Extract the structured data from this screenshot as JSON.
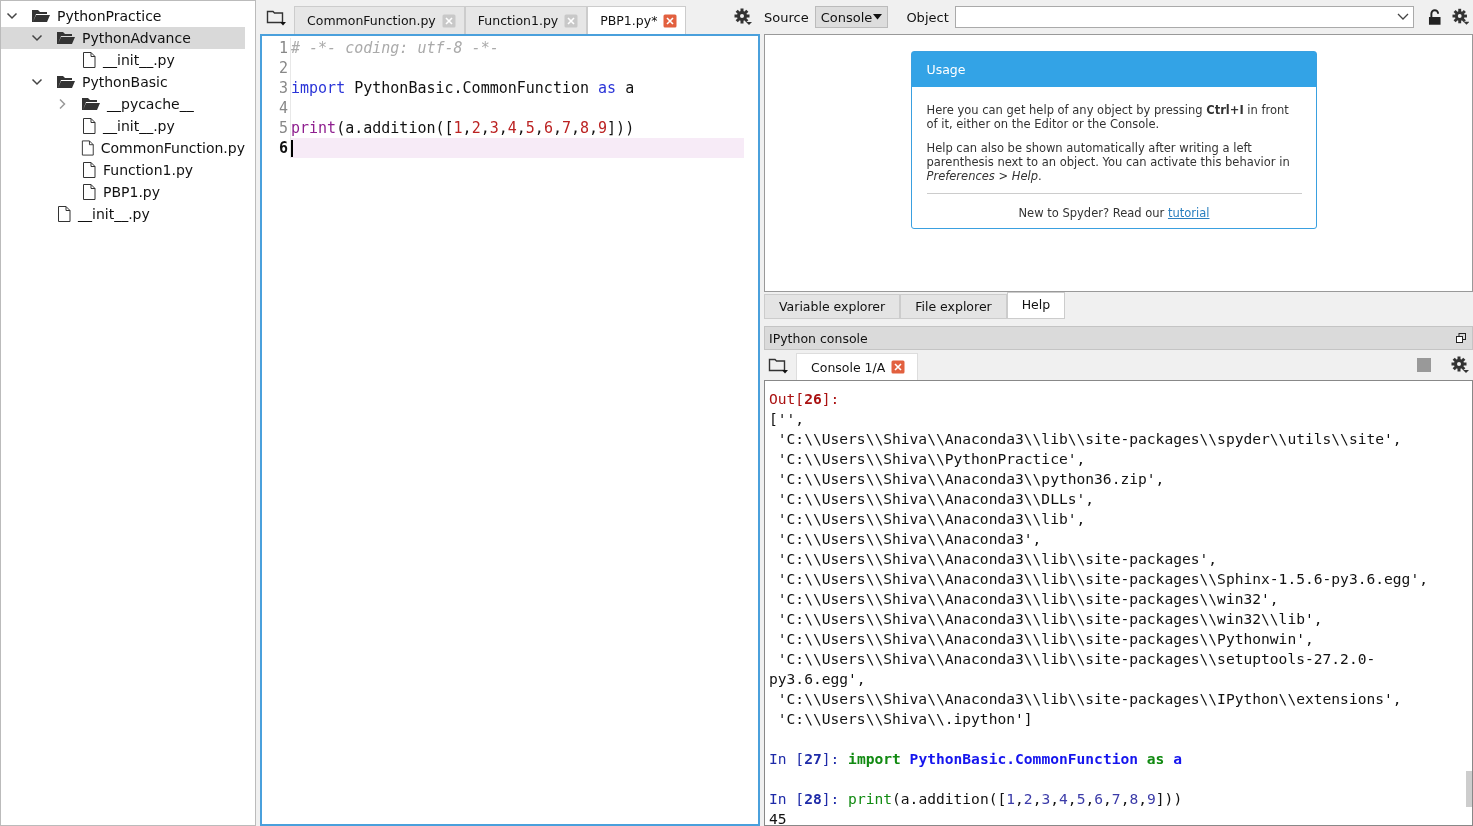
{
  "file_tree": [
    {
      "label": "PythonPractice",
      "kind": "folder",
      "expanded": true,
      "selected": false,
      "children": [
        {
          "label": "PythonAdvance",
          "kind": "folder",
          "expanded": true,
          "selected": true,
          "children": [
            {
              "label": "__init__.py",
              "kind": "file",
              "selected": false
            }
          ]
        },
        {
          "label": "PythonBasic",
          "kind": "folder",
          "expanded": true,
          "selected": false,
          "children": [
            {
              "label": "__pycache__",
              "kind": "folder",
              "expanded": false,
              "selected": false
            },
            {
              "label": "__init__.py",
              "kind": "file",
              "selected": false
            },
            {
              "label": "CommonFunction.py",
              "kind": "file",
              "selected": false
            },
            {
              "label": "Function1.py",
              "kind": "file",
              "selected": false
            },
            {
              "label": "PBP1.py",
              "kind": "file",
              "selected": false
            }
          ]
        },
        {
          "label": "__init__.py",
          "kind": "file",
          "selected": false
        }
      ]
    }
  ],
  "editor": {
    "tabs": [
      {
        "label": "CommonFunction.py",
        "selected": false
      },
      {
        "label": "Function1.py",
        "selected": false
      },
      {
        "label": "PBP1.py*",
        "selected": true
      }
    ],
    "lines": [
      {
        "number": "1",
        "current": false,
        "tokens": [
          {
            "text": "# -*- coding: utf-8 -*-",
            "kind": "comment"
          }
        ]
      },
      {
        "number": "2",
        "current": false
      },
      {
        "number": "3",
        "current": false,
        "tokens": [
          {
            "text": "import",
            "kind": "keyword"
          },
          {
            "text": " PythonBasic.CommonFunction ",
            "kind": "plain"
          },
          {
            "text": "as",
            "kind": "keyword"
          },
          {
            "text": " a",
            "kind": "plain"
          }
        ]
      },
      {
        "number": "4",
        "current": false
      },
      {
        "number": "5",
        "current": false,
        "tokens": [
          {
            "text": "print",
            "kind": "builtin"
          },
          {
            "text": "(a.addition([",
            "kind": "plain"
          },
          {
            "text": "1",
            "kind": "number"
          },
          {
            "text": ",",
            "kind": "plain"
          },
          {
            "text": "2",
            "kind": "number"
          },
          {
            "text": ",",
            "kind": "plain"
          },
          {
            "text": "3",
            "kind": "number"
          },
          {
            "text": ",",
            "kind": "plain"
          },
          {
            "text": "4",
            "kind": "number"
          },
          {
            "text": ",",
            "kind": "plain"
          },
          {
            "text": "5",
            "kind": "number"
          },
          {
            "text": ",",
            "kind": "plain"
          },
          {
            "text": "6",
            "kind": "number"
          },
          {
            "text": ",",
            "kind": "plain"
          },
          {
            "text": "7",
            "kind": "number"
          },
          {
            "text": ",",
            "kind": "plain"
          },
          {
            "text": "8",
            "kind": "number"
          },
          {
            "text": ",",
            "kind": "plain"
          },
          {
            "text": "9",
            "kind": "number"
          },
          {
            "text": "]))",
            "kind": "plain"
          }
        ]
      },
      {
        "number": "6",
        "current": true
      }
    ]
  },
  "help": {
    "source_label": "Source",
    "source_value": "Console",
    "object_label": "Object",
    "usage_title": "Usage",
    "paragraphs": [
      "Here you can get help of any object by pressing **Ctrl+I** in front of it, either on the Editor or the Console.",
      "Help can also be shown automatically after writing a left parenthesis next to an object. You can activate this behavior in *Preferences > Help*."
    ],
    "footer_text": "New to Spyder? Read our",
    "footer_link": "tutorial"
  },
  "pane_tabs": [
    {
      "label": "Variable explorer",
      "selected": false
    },
    {
      "label": "File explorer",
      "selected": false
    },
    {
      "label": "Help",
      "selected": true
    }
  ],
  "console": {
    "title": "IPython console",
    "tabs": [
      {
        "label": "Console 1/A",
        "selected": true
      }
    ],
    "lines": [
      [
        {
          "text": "Out[",
          "kind": "out"
        },
        {
          "text": "26",
          "kind": "out_num"
        },
        {
          "text": "]:",
          "kind": "out"
        }
      ],
      [
        {
          "text": "['',",
          "kind": "plain"
        }
      ],
      [
        {
          "text": " 'C:\\\\Users\\\\Shiva\\\\Anaconda3\\\\lib\\\\site-packages\\\\spyder\\\\utils\\\\site',",
          "kind": "plain"
        }
      ],
      [
        {
          "text": " 'C:\\\\Users\\\\Shiva\\\\PythonPractice',",
          "kind": "plain"
        }
      ],
      [
        {
          "text": " 'C:\\\\Users\\\\Shiva\\\\Anaconda3\\\\python36.zip',",
          "kind": "plain"
        }
      ],
      [
        {
          "text": " 'C:\\\\Users\\\\Shiva\\\\Anaconda3\\\\DLLs',",
          "kind": "plain"
        }
      ],
      [
        {
          "text": " 'C:\\\\Users\\\\Shiva\\\\Anaconda3\\\\lib',",
          "kind": "plain"
        }
      ],
      [
        {
          "text": " 'C:\\\\Users\\\\Shiva\\\\Anaconda3',",
          "kind": "plain"
        }
      ],
      [
        {
          "text": " 'C:\\\\Users\\\\Shiva\\\\Anaconda3\\\\lib\\\\site-packages',",
          "kind": "plain"
        }
      ],
      [
        {
          "text": " 'C:\\\\Users\\\\Shiva\\\\Anaconda3\\\\lib\\\\site-packages\\\\Sphinx-1.5.6-py3.6.egg',",
          "kind": "plain"
        }
      ],
      [
        {
          "text": " 'C:\\\\Users\\\\Shiva\\\\Anaconda3\\\\lib\\\\site-packages\\\\win32',",
          "kind": "plain"
        }
      ],
      [
        {
          "text": " 'C:\\\\Users\\\\Shiva\\\\Anaconda3\\\\lib\\\\site-packages\\\\win32\\\\lib',",
          "kind": "plain"
        }
      ],
      [
        {
          "text": " 'C:\\\\Users\\\\Shiva\\\\Anaconda3\\\\lib\\\\site-packages\\\\Pythonwin',",
          "kind": "plain"
        }
      ],
      [
        {
          "text": " 'C:\\\\Users\\\\Shiva\\\\Anaconda3\\\\lib\\\\site-packages\\\\setuptools-27.2.0-",
          "kind": "plain"
        }
      ],
      [
        {
          "text": "py3.6.egg',",
          "kind": "plain"
        }
      ],
      [
        {
          "text": " 'C:\\\\Users\\\\Shiva\\\\Anaconda3\\\\lib\\\\site-packages\\\\IPython\\\\extensions',",
          "kind": "plain"
        }
      ],
      [
        {
          "text": " 'C:\\\\Users\\\\Shiva\\\\.ipython']",
          "kind": "plain"
        }
      ],
      {
        "kind": "blank"
      },
      [
        {
          "text": "In [",
          "kind": "in"
        },
        {
          "text": "27",
          "kind": "in_num"
        },
        {
          "text": "]: ",
          "kind": "in"
        },
        {
          "text": "import",
          "kind": "keyword"
        },
        {
          "text": " PythonBasic.CommonFunction",
          "kind": "module"
        },
        {
          "text": " as",
          "kind": "keyword"
        },
        {
          "text": " a",
          "kind": "module"
        }
      ],
      {
        "kind": "blank"
      },
      [
        {
          "text": "In [",
          "kind": "in"
        },
        {
          "text": "28",
          "kind": "in_num"
        },
        {
          "text": "]: ",
          "kind": "in"
        },
        {
          "text": "print",
          "kind": "builtin"
        },
        {
          "text": "(a.addition([",
          "kind": "plain"
        },
        {
          "text": "1",
          "kind": "number"
        },
        {
          "text": ",",
          "kind": "plain"
        },
        {
          "text": "2",
          "kind": "number"
        },
        {
          "text": ",",
          "kind": "plain"
        },
        {
          "text": "3",
          "kind": "number"
        },
        {
          "text": ",",
          "kind": "plain"
        },
        {
          "text": "4",
          "kind": "number"
        },
        {
          "text": ",",
          "kind": "plain"
        },
        {
          "text": "5",
          "kind": "number"
        },
        {
          "text": ",",
          "kind": "plain"
        },
        {
          "text": "6",
          "kind": "number"
        },
        {
          "text": ",",
          "kind": "plain"
        },
        {
          "text": "7",
          "kind": "number"
        },
        {
          "text": ",",
          "kind": "plain"
        },
        {
          "text": "8",
          "kind": "number"
        },
        {
          "text": ",",
          "kind": "plain"
        },
        {
          "text": "9",
          "kind": "number"
        },
        {
          "text": "]))",
          "kind": "plain"
        }
      ],
      [
        {
          "text": "45",
          "kind": "plain"
        }
      ]
    ]
  }
}
